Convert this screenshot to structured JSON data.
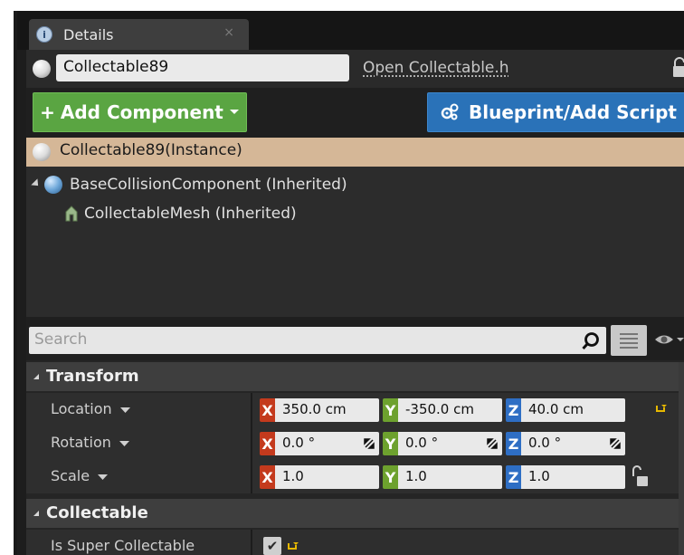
{
  "tab": {
    "label": "Details",
    "close": "×"
  },
  "actor": {
    "name": "Collectable89",
    "open_source_link": "Open Collectable.h"
  },
  "buttons": {
    "add_component": "Add Component",
    "blueprint": "Blueprint/Add Script"
  },
  "components": {
    "instance": "Collectable89(Instance)",
    "items": [
      {
        "label": "BaseCollisionComponent (Inherited)"
      },
      {
        "label": "CollectableMesh (Inherited)"
      }
    ]
  },
  "search": {
    "placeholder": "Search"
  },
  "transform": {
    "title": "Transform",
    "location": {
      "label": "Location",
      "x": "350.0 cm",
      "y": "-350.0 cm",
      "z": "40.0 cm"
    },
    "rotation": {
      "label": "Rotation",
      "x": "0.0 °",
      "y": "0.0 °",
      "z": "0.0 °"
    },
    "scale": {
      "label": "Scale",
      "x": "1.0",
      "y": "1.0",
      "z": "1.0"
    },
    "axes": {
      "x": "X",
      "y": "Y",
      "z": "Z"
    }
  },
  "collectable": {
    "title": "Collectable",
    "is_super": {
      "label": "Is Super Collectable",
      "checked": true,
      "check": "✔"
    }
  },
  "colors": {
    "add_button": "#5aa542",
    "blueprint_button": "#2a72b8",
    "instance_highlight": "#d5b797",
    "axis_x": "#c43a1d",
    "axis_y": "#6da12e",
    "axis_z": "#2e6ec4"
  }
}
